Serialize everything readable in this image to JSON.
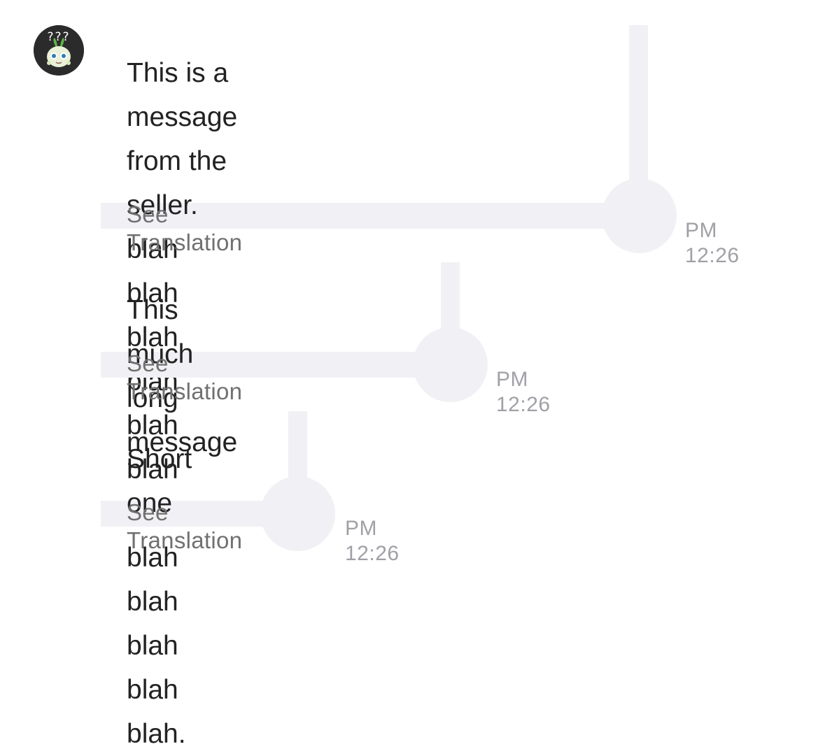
{
  "messages": [
    {
      "text": "This is a message from the seller. blah\nblah blah blah blah blah blah blah blah\nblah blah blah.",
      "translate_label": "See Translation",
      "time": "PM 12:26"
    },
    {
      "text": "This much long message",
      "translate_label": "See Translation",
      "time": "PM 12:26"
    },
    {
      "text": "Short one",
      "translate_label": "See Translation",
      "time": "PM 12:26"
    }
  ],
  "avatar": {
    "icon": "plant-creature-avatar",
    "badge_text": "???"
  },
  "colors": {
    "bubble_background": "#f1f1f5",
    "message_text": "#222222",
    "translate_link": "#707070",
    "timestamp": "#a0a0a6"
  }
}
